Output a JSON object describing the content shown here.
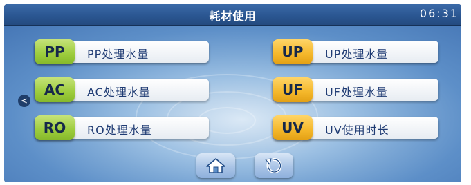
{
  "header": {
    "title": "耗材使用",
    "time": "06:31"
  },
  "left_buttons": [
    {
      "code": "PP",
      "label": "PP处理水量"
    },
    {
      "code": "AC",
      "label": "AC处理水量"
    },
    {
      "code": "RO",
      "label": "RO处理水量"
    }
  ],
  "right_buttons": [
    {
      "code": "UP",
      "label": "UP处理水量"
    },
    {
      "code": "UF",
      "label": "UF处理水量"
    },
    {
      "code": "UV",
      "label": "UV使用时长"
    }
  ],
  "nav": {
    "back_icon": "chevron-left-icon",
    "home_icon": "home-icon",
    "refresh_icon": "refresh-icon"
  },
  "colors": {
    "title_bar": "#2a5590",
    "tag_green": "#9ccc3c",
    "tag_yellow": "#f4b72a",
    "label_text": "#1f3b73"
  }
}
